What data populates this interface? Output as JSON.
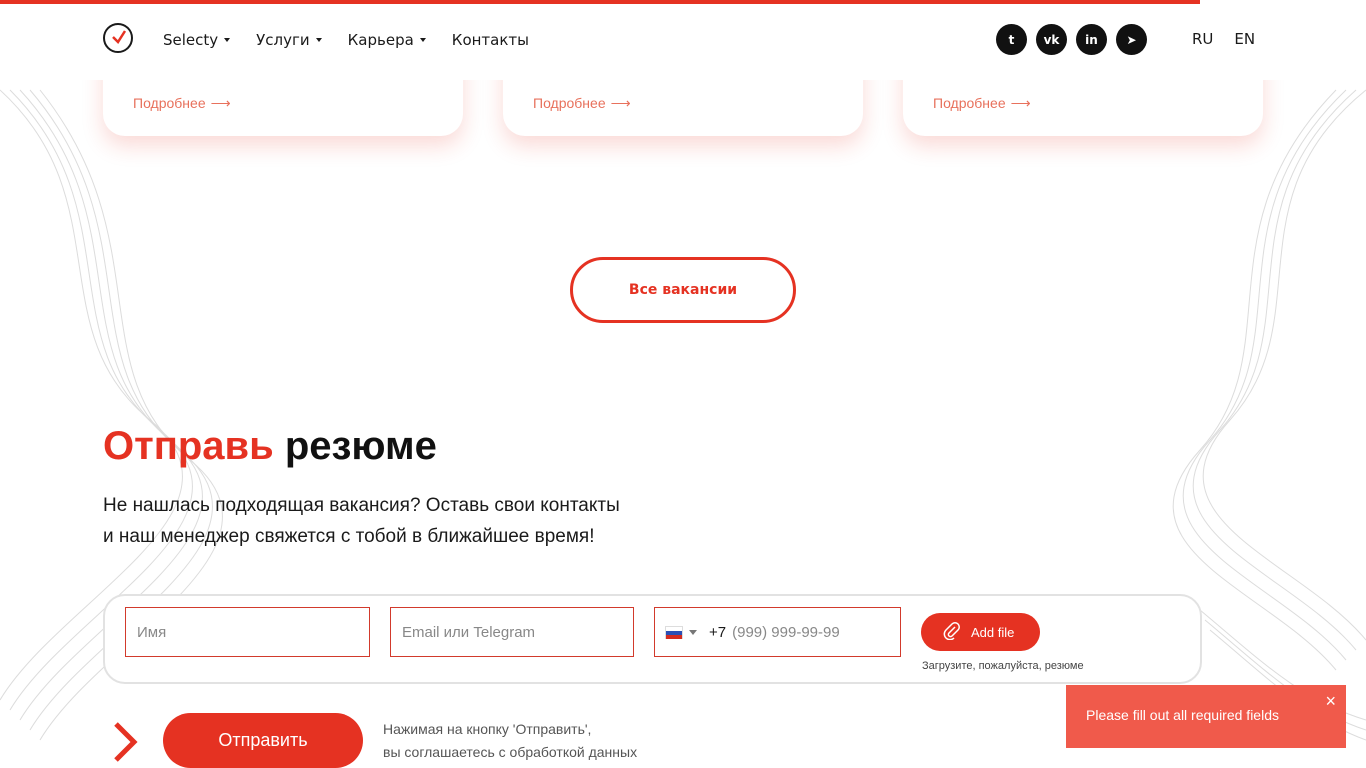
{
  "header": {
    "nav": [
      {
        "label": "Selecty",
        "has_dropdown": true
      },
      {
        "label": "Услуги",
        "has_dropdown": true
      },
      {
        "label": "Карьера",
        "has_dropdown": true
      },
      {
        "label": "Контакты",
        "has_dropdown": false
      }
    ],
    "socials": [
      {
        "icon": "twitter-icon",
        "glyph": "t"
      },
      {
        "icon": "vk-icon",
        "glyph": "vk"
      },
      {
        "icon": "linkedin-icon",
        "glyph": "in"
      },
      {
        "icon": "telegram-icon",
        "glyph": "➤"
      }
    ],
    "languages": [
      "RU",
      "EN"
    ]
  },
  "vacancy_cards": [
    {
      "link_label": "Подробнее",
      "arrow": "⟶"
    },
    {
      "link_label": "Подробнее",
      "arrow": "⟶"
    },
    {
      "link_label": "Подробнее",
      "arrow": "⟶"
    }
  ],
  "all_vacancies_label": "Все вакансии",
  "resume": {
    "title_accent": "Отправь",
    "title_rest": "резюме",
    "description": "Не нашлась подходящая вакансия? Оставь свои контакты и наш менеджер свяжется с тобой в ближайшее время!",
    "name_placeholder": "Имя",
    "contact_placeholder": "Email или Telegram",
    "phone_prefix": "+7",
    "phone_placeholder": "(999) 999-99-99",
    "add_file_label": "Add file",
    "file_hint": "Загрузите, пожалуйста, резюме",
    "submit_label": "Отправить",
    "consent_line1": "Нажимая на кнопку 'Отправить',",
    "consent_line2": "вы соглашаетесь с обработкой данных"
  },
  "toast": {
    "message": "Please fill out all required fields",
    "close_glyph": "×"
  },
  "colors": {
    "accent": "#e53222",
    "toast_bg": "#f05a4b",
    "link": "#e8715c"
  }
}
